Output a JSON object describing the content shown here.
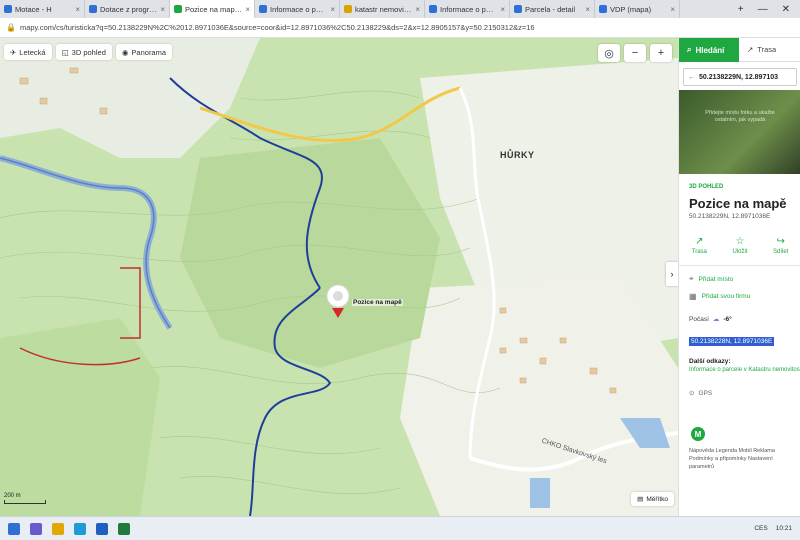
{
  "browser": {
    "tabs": [
      {
        "label": "Motace - H",
        "color": "#2f6fd6",
        "active": false
      },
      {
        "label": "Dotace z programu KUKV",
        "color": "#2f6fd6",
        "active": false
      },
      {
        "label": "Pozice na mapě • Mapy.cz",
        "color": "#1fa841",
        "active": true
      },
      {
        "label": "Informace o pozemku | Nahl",
        "color": "#2f6fd6",
        "active": false
      },
      {
        "label": "katastr nemovitosti nahlizen",
        "color": "#d9a400",
        "active": false
      },
      {
        "label": "Informace o parcele - azure",
        "color": "#2f6fd6",
        "active": false
      },
      {
        "label": "Parcela - detail",
        "color": "#2f6fd6",
        "active": false
      },
      {
        "label": "VDP (mapa)",
        "color": "#2f6fd6",
        "active": false
      }
    ],
    "url": "mapy.com/cs/turisticka?q=50.2138229N%2C%2012.8971036E&source=coor&id=12.8971036%2C50.2138229&ds=2&x=12.8905157&y=50.2150312&z=16"
  },
  "map": {
    "toolbar": [
      "Letecká",
      "3D pohled",
      "Panorama"
    ],
    "place_label": "HŮRKY",
    "pin_label": "Pozice na mapě",
    "chko_label": "CHKO Slavkovský les",
    "scale_label": "200 m",
    "legend_button": "Měřítko"
  },
  "panel": {
    "search_tab": "Hledání",
    "route_tab": "Trasa",
    "search_value": "50.2138229N, 12.897103",
    "photo_overlay": "Přidejte místu fotku a ukažte ostatním, jak vypadá",
    "label_3d": "3D POHLED",
    "title": "Pozice na mapě",
    "coords": "50.2138229N, 12.8971036E",
    "actions": [
      "Trasa",
      "Uložit",
      "Sdílet"
    ],
    "add_place": "Přidat místo",
    "add_company": "Přidat svou firmu",
    "weather_label": "Počasí",
    "weather_temp": "-6°",
    "selected_coords": "50.2138228N, 12.8971036E",
    "more_links_title": "Další odkazy:",
    "more_links": "Informace o parcele v Katastru nemovitostí",
    "gps": "GPS",
    "footer": "Nápověda Legenda Mobil Reklama Podmínky a připomínky Nastavení parametrů"
  },
  "taskbar": {
    "lang": "CES",
    "time": "10:21"
  }
}
